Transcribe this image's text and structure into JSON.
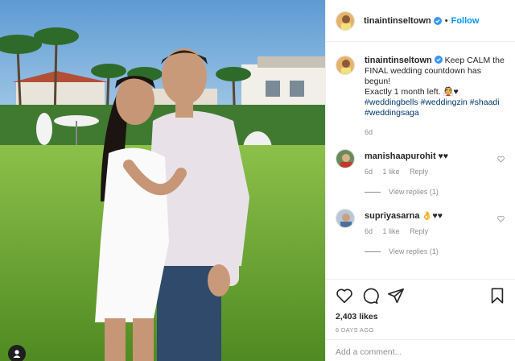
{
  "post": {
    "username": "tinaintinseltown",
    "follow_label": "Follow",
    "dot": "•",
    "caption_text": "Keep CALM the FINAL wedding countdown has begun!",
    "caption_line2": "Exactly 1 month left. 👰♥",
    "hashtags": [
      "#weddingbells",
      "#weddingzin",
      "#shaadi",
      "#weddingsaga"
    ],
    "caption_age": "6d",
    "likes": "2,403 likes",
    "date": "6 DAYS AGO",
    "add_comment_placeholder": "Add a comment..."
  },
  "comments": [
    {
      "username": "manishaapurohit",
      "text": "♥♥",
      "age": "6d",
      "likes": "1 like",
      "reply_label": "Reply",
      "view_replies": "View replies (1)"
    },
    {
      "username": "supriyasarna",
      "text": "👌♥♥",
      "age": "6d",
      "likes": "1 like",
      "reply_label": "Reply",
      "view_replies": "View replies (1)"
    }
  ],
  "colors": {
    "link_blue": "#0095f6",
    "hashtag": "#00376b",
    "muted": "#8e8e8e",
    "text": "#262626",
    "border": "#efefef"
  },
  "icons": {
    "like": "heart-outline-icon",
    "comment": "speech-bubble-icon",
    "share": "paper-plane-icon",
    "save": "bookmark-icon",
    "verified": "verified-badge-icon",
    "tagged_user": "user-tag-icon"
  }
}
